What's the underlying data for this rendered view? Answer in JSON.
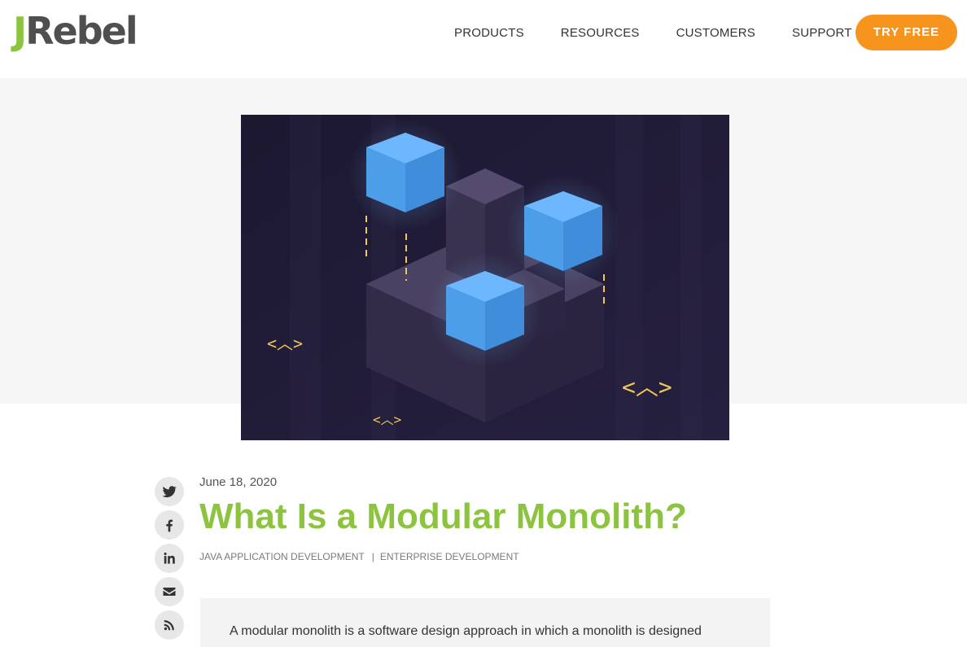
{
  "header": {
    "logo": {
      "j": "J",
      "rest": "Rebel"
    },
    "nav": [
      "PRODUCTS",
      "RESOURCES",
      "CUSTOMERS",
      "SUPPORT"
    ],
    "cta_label": "TRY FREE"
  },
  "hero": {
    "code_glyph_left": "<︿>",
    "code_glyph_bottom": "<︿>",
    "code_glyph_right": "<︿>"
  },
  "social": [
    "twitter-icon",
    "facebook-icon",
    "linkedin-icon",
    "email-icon",
    "rss-icon"
  ],
  "article": {
    "date": "June 18, 2020",
    "title": "What Is a Modular Monolith?",
    "categories": [
      "JAVA APPLICATION DEVELOPMENT",
      "ENTERPRISE DEVELOPMENT"
    ],
    "summary": "A modular monolith is a software design approach in which a monolith is designed"
  },
  "colors": {
    "brand_green": "#8cc43f",
    "cta_orange": "#f7941d",
    "hero_bg": "#211c36",
    "cube_blue": "#4da3f0"
  }
}
